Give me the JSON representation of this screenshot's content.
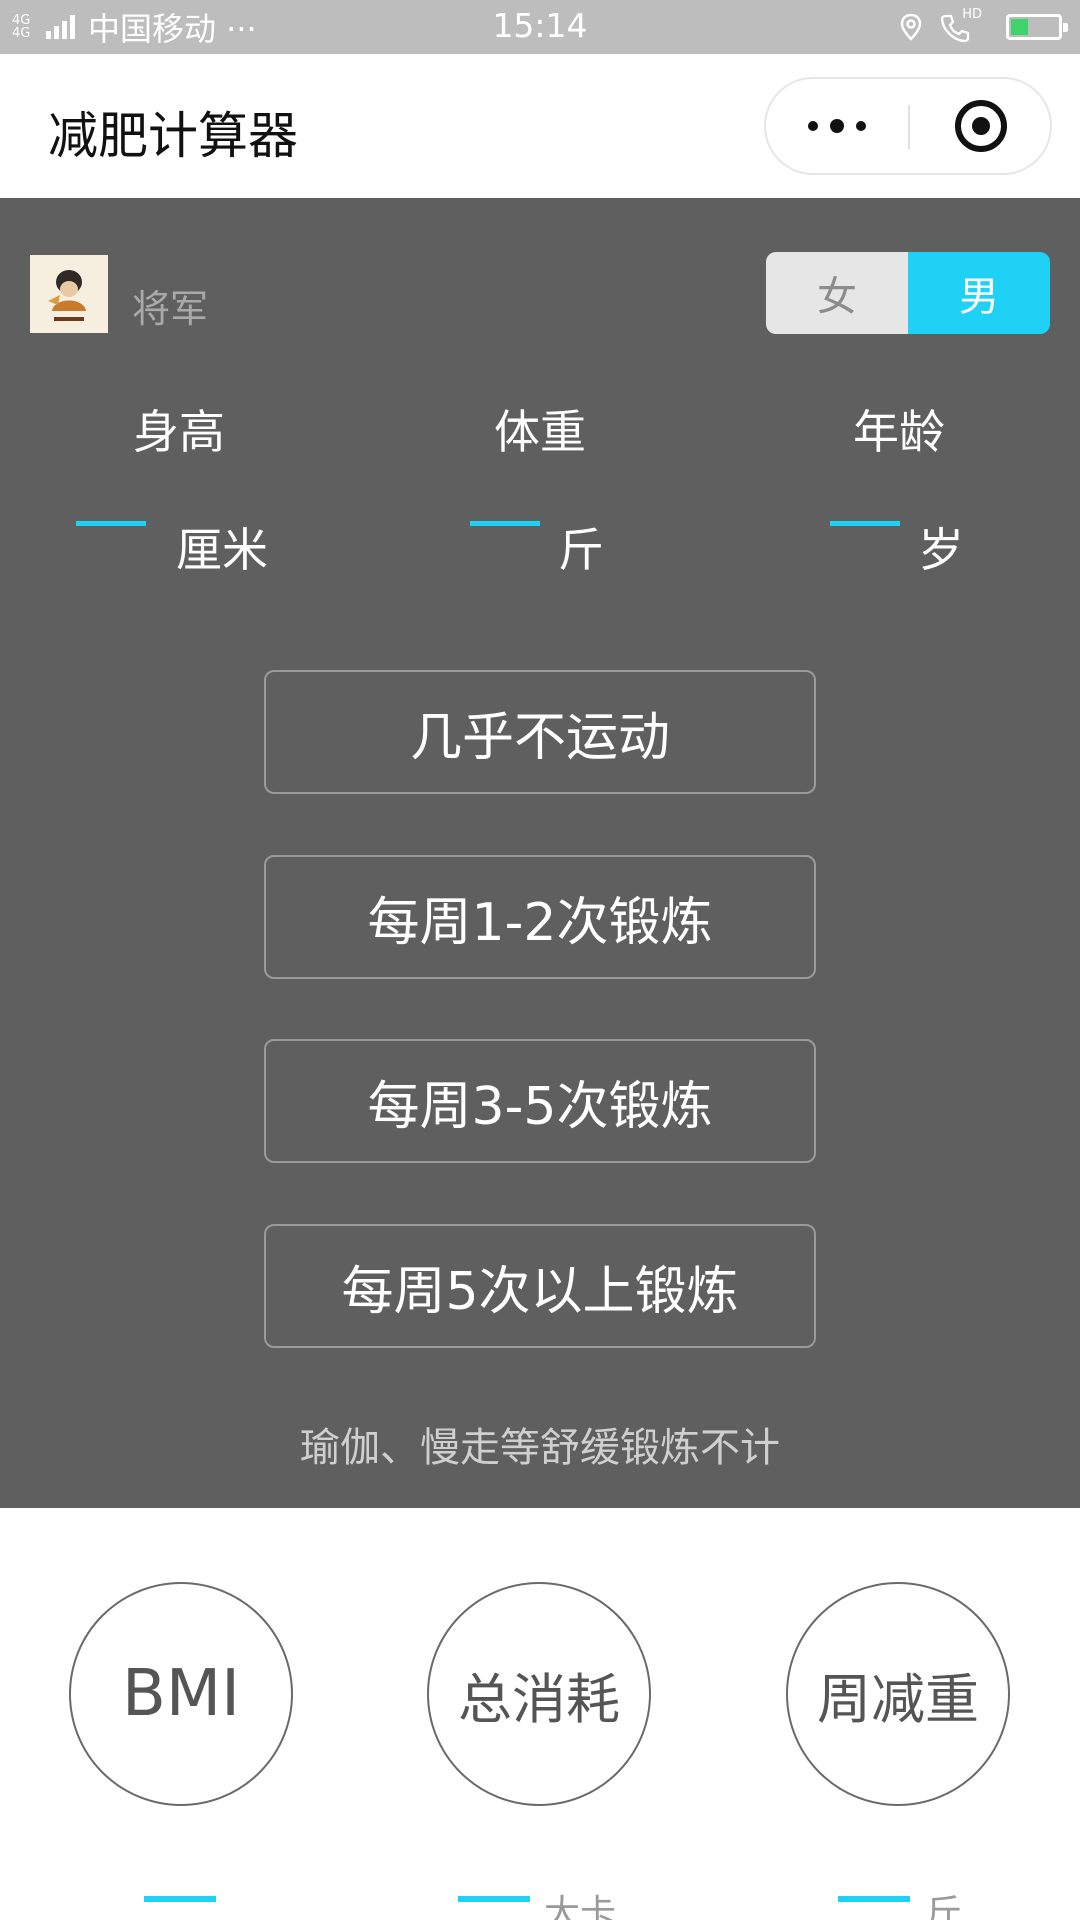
{
  "status_bar": {
    "network": "4G 4G",
    "carrier": "中国移动 ···",
    "time": "15:14",
    "hd": "HD",
    "battery_level": 0.35
  },
  "title_bar": {
    "title": "减肥计算器"
  },
  "user": {
    "name": "将军"
  },
  "gender": {
    "female": "女",
    "male": "男",
    "selected": "男"
  },
  "metrics": {
    "height": {
      "label": "身高",
      "unit": "厘米"
    },
    "weight": {
      "label": "体重",
      "unit": "斤"
    },
    "age": {
      "label": "年龄",
      "unit": "岁"
    }
  },
  "activity": {
    "options": [
      "几乎不运动",
      "每周1-2次锻炼",
      "每周3-5次锻炼",
      "每周5次以上锻炼"
    ],
    "note": "瑜伽、慢走等舒缓锻炼不计"
  },
  "results": {
    "bmi": {
      "label": "BMI",
      "unit": ""
    },
    "total": {
      "label": "总消耗",
      "unit": "大卡"
    },
    "weekly": {
      "label": "周减重",
      "unit": "斤"
    }
  },
  "colors": {
    "accent": "#1ed1f5",
    "panel": "#5f5f5f",
    "status_bar": "#bdbdbd"
  }
}
